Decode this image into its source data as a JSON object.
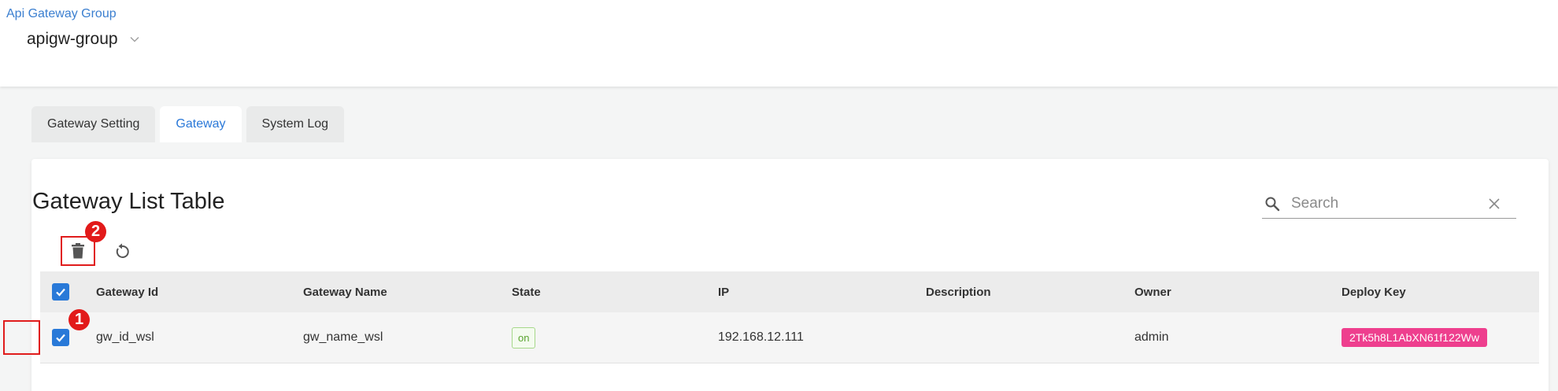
{
  "breadcrumb": "Api Gateway Group",
  "group_select": {
    "value": "apigw-group"
  },
  "tabs": [
    {
      "label": "Gateway Setting",
      "active": false
    },
    {
      "label": "Gateway",
      "active": true
    },
    {
      "label": "System Log",
      "active": false
    }
  ],
  "card": {
    "title": "Gateway List Table"
  },
  "search": {
    "placeholder": "Search",
    "value": ""
  },
  "annotations": {
    "badge_1": "1",
    "badge_2": "2"
  },
  "table": {
    "columns": [
      "Gateway Id",
      "Gateway Name",
      "State",
      "IP",
      "Description",
      "Owner",
      "Deploy Key"
    ],
    "rows": [
      {
        "checked": true,
        "gateway_id": "gw_id_wsl",
        "gateway_name": "gw_name_wsl",
        "state": "on",
        "ip": "192.168.12.111",
        "description": "",
        "owner": "admin",
        "deploy_key": "2Tk5h8L1AbXN61f122Ww"
      }
    ]
  },
  "colors": {
    "accent": "#2a78d8",
    "annotation_red": "#e21a1a",
    "state_green": "#5aa52f",
    "deploy_key_pink": "#ee3f8e"
  },
  "icons": [
    "chevron-down-icon",
    "search-icon",
    "clear-icon",
    "delete-icon",
    "refresh-icon",
    "checkmark-icon"
  ]
}
